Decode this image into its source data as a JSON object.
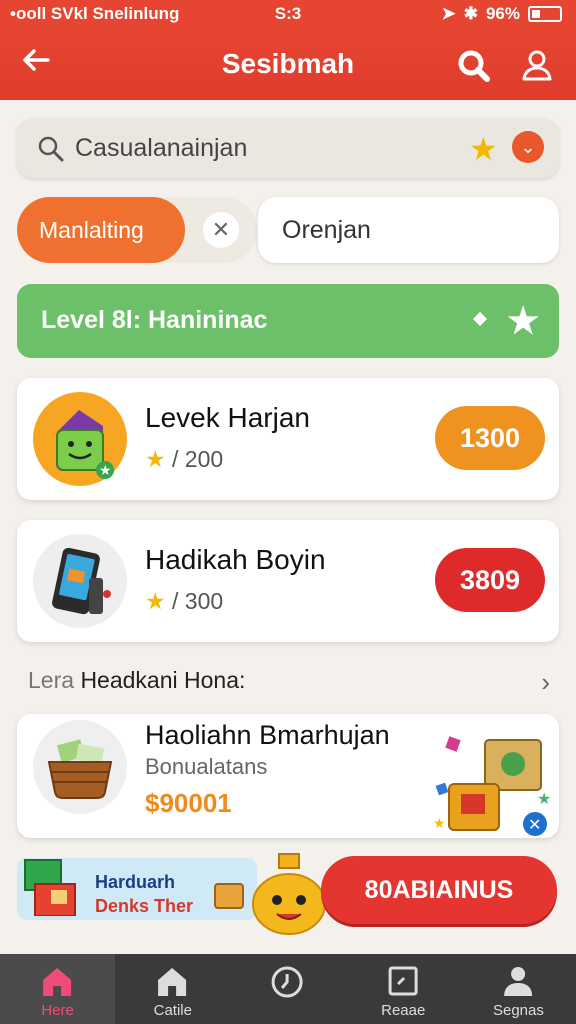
{
  "status_bar": {
    "carrier": "•ooll SVkl Snelinlung",
    "time": "S:3",
    "battery": "96%"
  },
  "header": {
    "title": "Sesibmah"
  },
  "search": {
    "value": "Casualanainjan"
  },
  "filters": {
    "active_chip": "Manlalting",
    "secondary": "Orenjan"
  },
  "level_banner": {
    "text": "Level 8l: Hanininac"
  },
  "items": [
    {
      "name": "Levek Harjan",
      "rating": "/ 200",
      "price": "1300",
      "price_color": "#f0921f"
    },
    {
      "name": "Hadikah Boyin",
      "rating": "/ 300",
      "price": "3809",
      "price_color": "#de2a2a"
    }
  ],
  "section": {
    "prefix": "Lera",
    "title": "Headkani Hona:"
  },
  "gift": {
    "name": "Haoliahn Bmarhujan",
    "subtitle": "Bonualatans",
    "price": "$90001"
  },
  "promo": {
    "line1": "Harduarh",
    "line2": "Denks Ther",
    "button": "80ABIAINUS"
  },
  "nav": [
    {
      "label": "Here",
      "icon": "home-icon",
      "active": true
    },
    {
      "label": "Catile",
      "icon": "house-icon",
      "active": false
    },
    {
      "label": "",
      "icon": "clock-icon",
      "active": false
    },
    {
      "label": "Reaae",
      "icon": "square-icon",
      "active": false
    },
    {
      "label": "Segnas",
      "icon": "person-icon",
      "active": false
    }
  ]
}
